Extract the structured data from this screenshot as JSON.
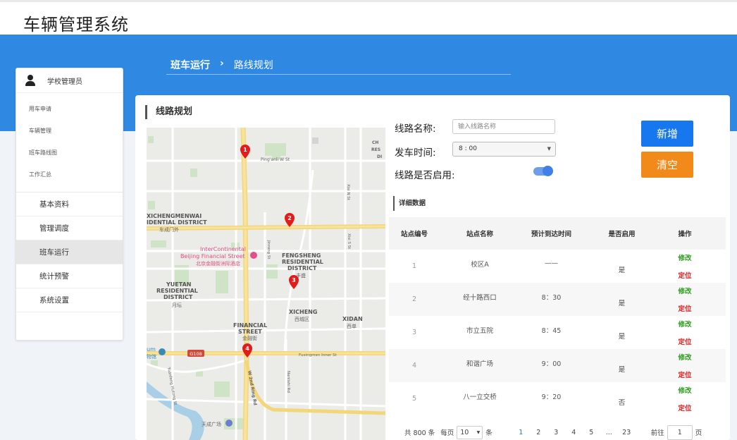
{
  "app": {
    "title": "车辆管理系统"
  },
  "breadcrumb": {
    "parent": "班车运行",
    "separator": "›",
    "current": "路线规划"
  },
  "sidebar": {
    "user": "学校管理员",
    "sub_items": [
      "用车申请",
      "车辆管理",
      "班车路线图",
      "工作汇总"
    ],
    "main_items": [
      "基本资料",
      "管理调度",
      "班车运行",
      "统计预警",
      "系统设置"
    ],
    "active": "班车运行"
  },
  "section_title": "线路规划",
  "form": {
    "route_name_label": "线路名称:",
    "route_name_placeholder": "输入线路名称",
    "depart_time_label": "发车时间:",
    "depart_time_value": "8 : 00",
    "enabled_label": "线路是否启用:",
    "enabled": true
  },
  "buttons": {
    "add": "新增",
    "clear": "清空"
  },
  "detail_title": "详细数据",
  "table": {
    "headers": [
      "站点编号",
      "站点名称",
      "预计到达时间",
      "是否启用",
      "操作"
    ],
    "rows": [
      {
        "no": "1",
        "name": "校区A",
        "time": "——",
        "enabled": "是"
      },
      {
        "no": "2",
        "name": "经十路西口",
        "time": "8：30",
        "enabled": "是"
      },
      {
        "no": "3",
        "name": "市立五院",
        "time": "8：45",
        "enabled": "是"
      },
      {
        "no": "4",
        "name": "和谐广场",
        "time": "9：00",
        "enabled": "是"
      },
      {
        "no": "5",
        "name": "八一立交桥",
        "time": "9：20",
        "enabled": "否"
      }
    ],
    "action_edit": "修改",
    "action_locate": "定位"
  },
  "pagination": {
    "total": "共 800 条",
    "per_page_label": "每页",
    "per_page_value": "10",
    "per_page_unit": "条",
    "pages": [
      "1",
      "2",
      "3",
      "4",
      "5",
      "...",
      "23"
    ],
    "current": "1",
    "goto_label": "前往",
    "goto_value": "1",
    "goto_unit": "页"
  },
  "map": {
    "labels": {
      "pingan": "Ping'anli W St",
      "chegongzhuang": "CH",
      "res1": "RES",
      "di": "DI",
      "xizhimen": "XICHENGMENWAI",
      "xizhimen2": "IDENTIAL DISTRICT",
      "xizhimen_cn": "车成门外",
      "intercontinental": "InterContinental",
      "beijing_fin": "Beijing Financial Street",
      "intercontinental_cn": "北京金融街洲际酒店",
      "fengsheng": "FENGSHENG",
      "fengsheng2": "RESIDENTIAL",
      "fengsheng3": "DISTRICT",
      "fengsheng_cn": "丰盛",
      "yuetan": "YUETAN",
      "yuetan2": "RESIDENTIAL",
      "yuetan3": "DISTRICT",
      "yuetan_cn": "月坛",
      "xicheng": "XICHENG",
      "xicheng_cn": "西城区",
      "xidan": "XIDAN",
      "xidan_cn": "西单",
      "financial": "FINANCIAL",
      "financial2": "STREET",
      "financial_cn": "金融街",
      "fuxingmen": "Fuxingmen Inner St",
      "w2nd": "W 2nd Ring Rd",
      "g108": "G108",
      "um": "um",
      "um_cn": "物馆",
      "tiancheng": "天成广场",
      "jinrong": "Jinrong St",
      "xisi": "Xisi N St",
      "xisi_s": "Xisi S St",
      "nanlishi": "Nanlishi Rd",
      "fengsheng_st": "Yuanfeng Hutong St"
    },
    "markers": [
      "1",
      "2",
      "3",
      "4"
    ]
  }
}
